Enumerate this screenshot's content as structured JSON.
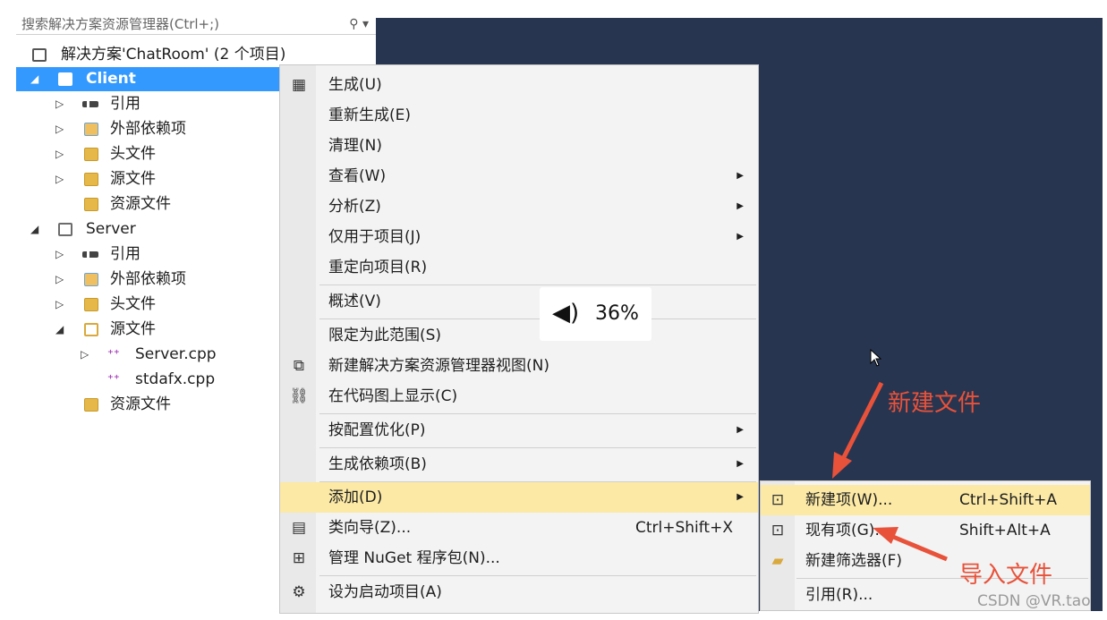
{
  "explorer": {
    "search_placeholder": "搜索解决方案资源管理器(Ctrl+;)",
    "solution": "解决方案'ChatRoom' (2 个项目)",
    "client": {
      "name": "Client",
      "references": "引用",
      "external_deps": "外部依赖项",
      "header_files": "头文件",
      "source_files": "源文件",
      "resource_files": "资源文件"
    },
    "server": {
      "name": "Server",
      "references": "引用",
      "external_deps": "外部依赖项",
      "header_files": "头文件",
      "source_files": "源文件",
      "file_server": "Server.cpp",
      "file_stdafx": "stdafx.cpp",
      "resource_files": "资源文件"
    }
  },
  "context_menu": {
    "items": [
      {
        "label": "生成(U)",
        "icon": "build-icon"
      },
      {
        "label": "重新生成(E)"
      },
      {
        "label": "清理(N)"
      },
      {
        "label": "查看(W)",
        "submenu": true
      },
      {
        "label": "分析(Z)",
        "submenu": true
      },
      {
        "label": "仅用于项目(J)",
        "submenu": true
      },
      {
        "label": "重定向项目(R)"
      },
      {
        "label": "概述(V)"
      },
      {
        "label": "限定为此范围(S)"
      },
      {
        "label": "新建解决方案资源管理器视图(N)",
        "icon": "new-view-icon"
      },
      {
        "label": "在代码图上显示(C)",
        "icon": "code-map-icon"
      },
      {
        "label": "按配置优化(P)",
        "submenu": true
      },
      {
        "label": "生成依赖项(B)",
        "submenu": true
      },
      {
        "label": "添加(D)",
        "submenu": true,
        "highlighted": true
      },
      {
        "label": "类向导(Z)...",
        "shortcut": "Ctrl+Shift+X",
        "icon": "class-wizard-icon"
      },
      {
        "label": "管理 NuGet 程序包(N)...",
        "icon": "nuget-icon"
      },
      {
        "label": "设为启动项目(A)",
        "icon": "gear-icon"
      }
    ]
  },
  "add_submenu": {
    "items": [
      {
        "label": "新建项(W)...",
        "shortcut": "Ctrl+Shift+A",
        "highlighted": true
      },
      {
        "label": "现有项(G)...",
        "shortcut": "Shift+Alt+A"
      },
      {
        "label": "新建筛选器(F)"
      },
      {
        "label": "引用(R)..."
      }
    ]
  },
  "volume_overlay": {
    "percent": "36%"
  },
  "annotations": {
    "new_file": "新建文件",
    "import_file": "导入文件"
  },
  "watermark": "CSDN @VR.tao",
  "colors": {
    "selection": "#3399ff",
    "editor_bg": "#283550",
    "menu_highlight": "#fbe9a5",
    "annotation": "#e8523a"
  }
}
